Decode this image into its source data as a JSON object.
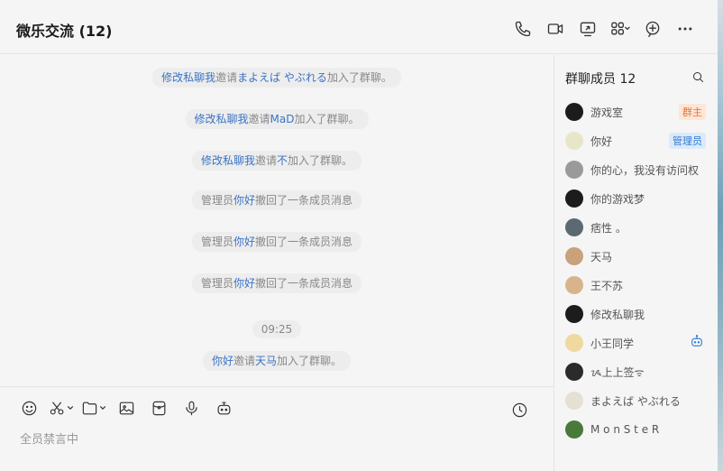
{
  "header": {
    "title": "微乐交流 (12)"
  },
  "messages": [
    {
      "parts": [
        {
          "t": "修改私聊我",
          "link": true
        },
        {
          "t": "邀请",
          "link": false
        },
        {
          "t": "まよえば やぶれる",
          "link": true
        },
        {
          "t": "加入了群聊。",
          "link": false
        }
      ]
    },
    {
      "parts": [
        {
          "t": "修改私聊我",
          "link": true
        },
        {
          "t": "邀请",
          "link": false
        },
        {
          "t": "MaD",
          "link": true
        },
        {
          "t": "加入了群聊。",
          "link": false
        }
      ]
    },
    {
      "parts": [
        {
          "t": "修改私聊我",
          "link": true
        },
        {
          "t": "邀请",
          "link": false
        },
        {
          "t": "不",
          "link": true
        },
        {
          "t": "加入了群聊。",
          "link": false
        }
      ]
    },
    {
      "parts": [
        {
          "t": "管理员",
          "link": false
        },
        {
          "t": "你好",
          "link": true
        },
        {
          "t": "撤回了一条成员消息",
          "link": false
        }
      ]
    },
    {
      "parts": [
        {
          "t": "管理员",
          "link": false
        },
        {
          "t": "你好",
          "link": true
        },
        {
          "t": "撤回了一条成员消息",
          "link": false
        }
      ]
    },
    {
      "parts": [
        {
          "t": "管理员",
          "link": false
        },
        {
          "t": "你好",
          "link": true
        },
        {
          "t": "撤回了一条成员消息",
          "link": false
        }
      ]
    },
    {
      "time": "09:25"
    },
    {
      "parts": [
        {
          "t": "你好",
          "link": true
        },
        {
          "t": "邀请",
          "link": false
        },
        {
          "t": "天马",
          "link": true
        },
        {
          "t": "加入了群聊。",
          "link": false
        }
      ]
    }
  ],
  "composer": {
    "muted_text": "全员禁言中"
  },
  "panel": {
    "title": "群聊成员 12",
    "members": [
      {
        "name": "游戏室",
        "badge": "群主",
        "badge_type": "owner",
        "avatar": "#1c1c1c"
      },
      {
        "name": "你好",
        "badge": "管理员",
        "badge_type": "admin",
        "avatar": "#e8e6c8"
      },
      {
        "name": "你的心，我没有访问权",
        "avatar": "#9a9a9a"
      },
      {
        "name": "你的游戏梦",
        "avatar": "#1c1c1c"
      },
      {
        "name": "痞性 。",
        "avatar": "#5a6a70"
      },
      {
        "name": "天马",
        "avatar": "#c9a17a"
      },
      {
        "name": "王不苏",
        "avatar": "#d8b48c"
      },
      {
        "name": "修改私聊我",
        "avatar": "#1c1c1c"
      },
      {
        "name": "小王同学",
        "bot": true,
        "avatar": "#f0d9a0"
      },
      {
        "name": "ᝰ上上签ᯤ",
        "avatar": "#2b2b2b"
      },
      {
        "name": "まよえば やぶれる",
        "avatar": "#e4e0d2"
      },
      {
        "name": "M o n S t e R",
        "avatar": "#4a7a3a"
      }
    ]
  },
  "colors": {
    "link": "#3b73c4",
    "owner_badge": "#e0763a",
    "admin_badge": "#2f7bd6"
  }
}
